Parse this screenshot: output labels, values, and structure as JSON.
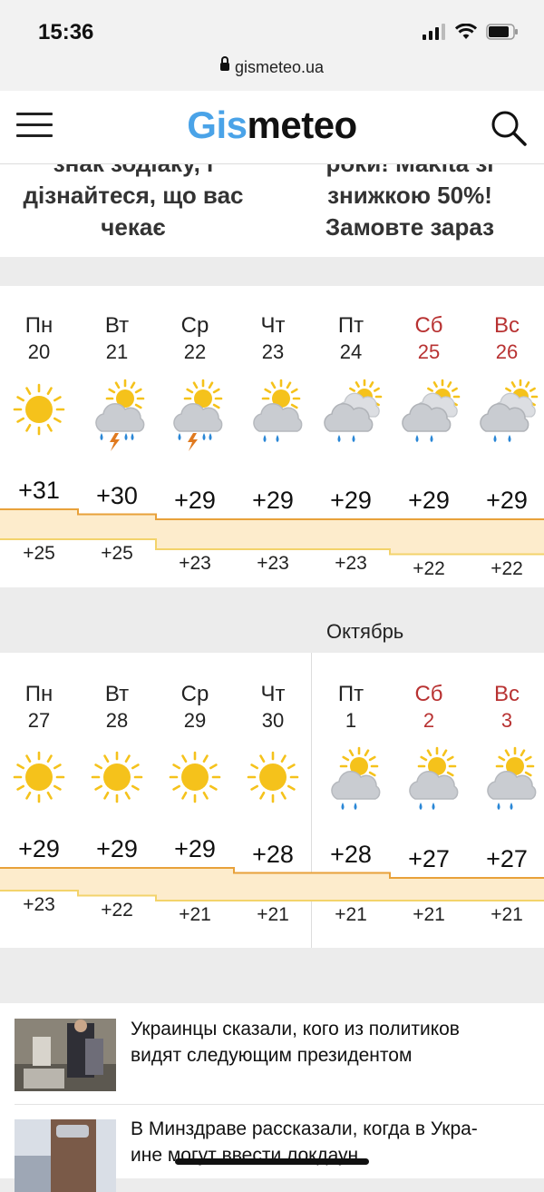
{
  "status": {
    "time": "15:36",
    "url": "gismeteo.ua"
  },
  "header": {
    "logo_part1": "Gis",
    "logo_part2": "meteo"
  },
  "ads": {
    "left": {
      "line0": "знак зодіаку, і",
      "line1": "дізнайтеся, що вас",
      "line2": "чекає"
    },
    "right": {
      "line0": "роки! Makita зі",
      "line1": "знижкою 50%!",
      "line2": "Замовте зараз"
    }
  },
  "week1": [
    {
      "name": "Пн",
      "num": "20",
      "weekend": false,
      "icon": "sun-icon",
      "max": "+31",
      "min": "+25"
    },
    {
      "name": "Вт",
      "num": "21",
      "weekend": false,
      "icon": "thunderstorm-icon",
      "max": "+30",
      "min": "+25"
    },
    {
      "name": "Ср",
      "num": "22",
      "weekend": false,
      "icon": "thunderstorm-icon",
      "max": "+29",
      "min": "+23"
    },
    {
      "name": "Чт",
      "num": "23",
      "weekend": false,
      "icon": "sun-cloud-rain-icon",
      "max": "+29",
      "min": "+23"
    },
    {
      "name": "Пт",
      "num": "24",
      "weekend": false,
      "icon": "cloudy-rain-icon",
      "max": "+29",
      "min": "+23"
    },
    {
      "name": "Сб",
      "num": "25",
      "weekend": true,
      "icon": "cloudy-rain-icon",
      "max": "+29",
      "min": "+22"
    },
    {
      "name": "Вс",
      "num": "26",
      "weekend": true,
      "icon": "cloudy-rain-icon",
      "max": "+29",
      "min": "+22"
    }
  ],
  "month_label": "Октябрь",
  "week2": [
    {
      "name": "Пн",
      "num": "27",
      "weekend": false,
      "icon": "sun-icon",
      "max": "+29",
      "min": "+23"
    },
    {
      "name": "Вт",
      "num": "28",
      "weekend": false,
      "icon": "sun-icon",
      "max": "+29",
      "min": "+22"
    },
    {
      "name": "Ср",
      "num": "29",
      "weekend": false,
      "icon": "sun-icon",
      "max": "+29",
      "min": "+21"
    },
    {
      "name": "Чт",
      "num": "30",
      "weekend": false,
      "icon": "sun-icon",
      "max": "+28",
      "min": "+21"
    },
    {
      "name": "Пт",
      "num": "1",
      "weekend": false,
      "icon": "sun-cloud-rain-icon",
      "max": "+28",
      "min": "+21"
    },
    {
      "name": "Сб",
      "num": "2",
      "weekend": true,
      "icon": "sun-cloud-rain-icon",
      "max": "+27",
      "min": "+21"
    },
    {
      "name": "Вс",
      "num": "3",
      "weekend": true,
      "icon": "sun-cloud-rain-icon",
      "max": "+27",
      "min": "+21"
    }
  ],
  "news": [
    {
      "line1": "Украинцы сказали, кого из политиков",
      "line2": "видят следующим президентом"
    },
    {
      "line1": "В Минздраве рассказали, когда в Укра-",
      "line2": "ине могут ввести локдаун"
    }
  ],
  "colors": {
    "accent": "#4aa3e8",
    "weekend": "#b83232",
    "sun": "#f5c21b",
    "band_max": "#e8a13a",
    "band_min": "#f3d36b",
    "band_fill": "#fdeccc"
  }
}
